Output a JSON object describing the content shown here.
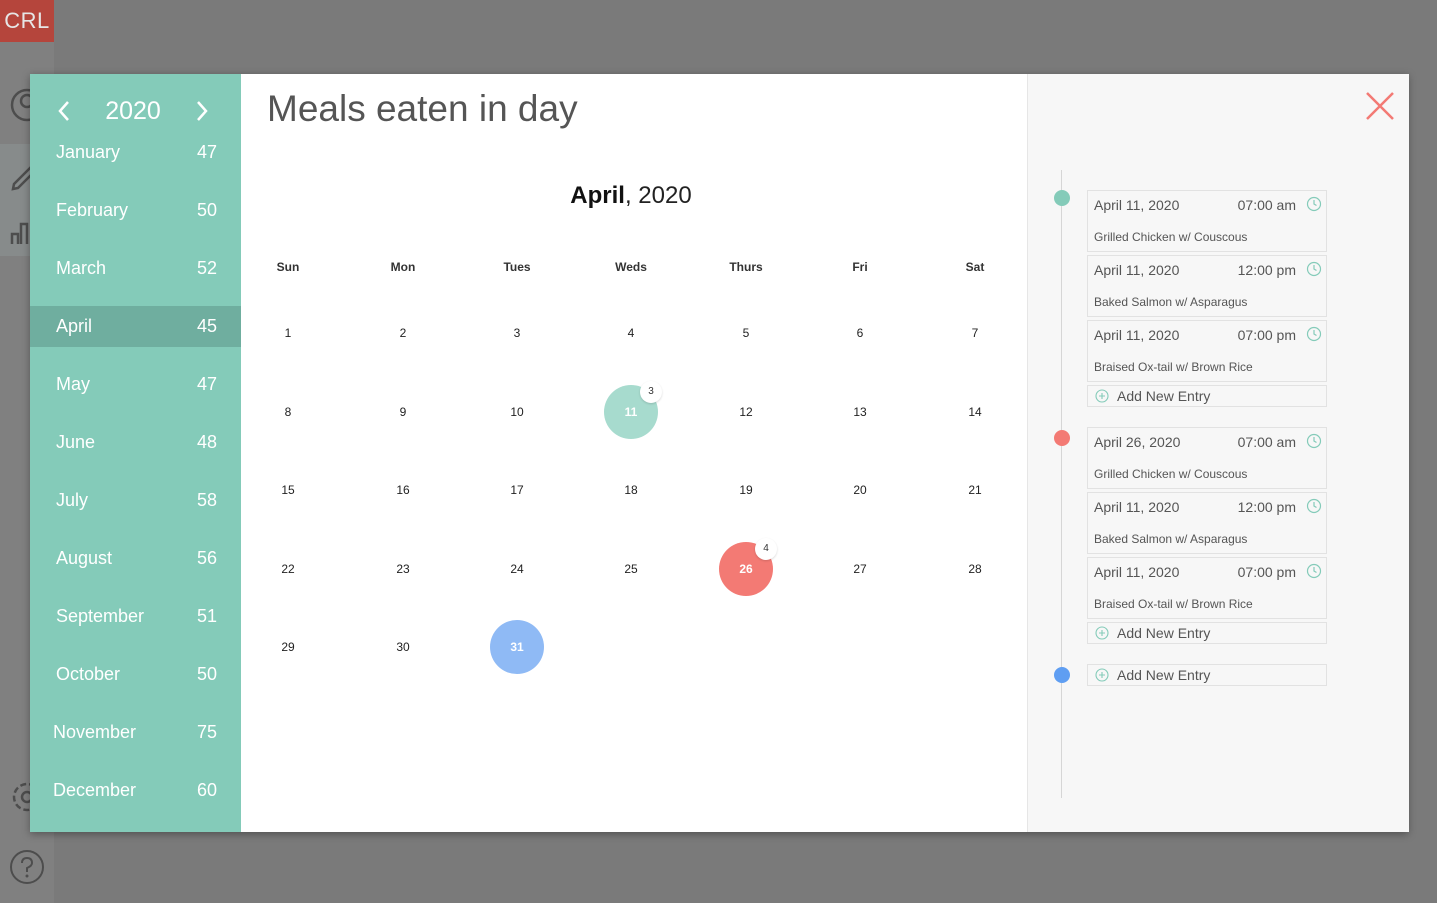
{
  "app": {
    "logo": "CRL"
  },
  "modal": {
    "title": "Meals eaten in day",
    "year": "2020",
    "months": [
      {
        "name": "January",
        "count": "47"
      },
      {
        "name": "February",
        "count": "50"
      },
      {
        "name": "March",
        "count": "52"
      },
      {
        "name": "April",
        "count": "45"
      },
      {
        "name": "May",
        "count": "47"
      },
      {
        "name": "June",
        "count": "48"
      },
      {
        "name": "July",
        "count": "58"
      },
      {
        "name": "August",
        "count": "56"
      },
      {
        "name": "September",
        "count": "51"
      },
      {
        "name": "October",
        "count": "50"
      },
      {
        "name": "November",
        "count": "75"
      },
      {
        "name": "December",
        "count": "60"
      }
    ],
    "selected_month": "April",
    "calendar": {
      "month": "April",
      "year_suffix": ", 2020",
      "weekdays": [
        "Sun",
        "Mon",
        "Tues",
        "Weds",
        "Thurs",
        "Fri",
        "Sat"
      ],
      "weeks": [
        [
          "1",
          "2",
          "3",
          "4",
          "5",
          "6",
          "7"
        ],
        [
          "8",
          "9",
          "10",
          "11",
          "12",
          "13",
          "14"
        ],
        [
          "15",
          "16",
          "17",
          "18",
          "19",
          "20",
          "21"
        ],
        [
          "22",
          "23",
          "24",
          "25",
          "26",
          "27",
          "28"
        ],
        [
          "29",
          "30",
          "31"
        ]
      ],
      "highlights": {
        "11": {
          "color": "#a7dbce",
          "badge": "3"
        },
        "26": {
          "color": "#f37a74",
          "badge": "4"
        },
        "31": {
          "color": "#8fbaf5"
        }
      }
    },
    "timeline": {
      "groups": [
        {
          "dot_color": "#84cbb9",
          "entries": [
            {
              "date": "April 11, 2020",
              "time": "07:00 am",
              "meal": "Grilled Chicken w/ Couscous"
            },
            {
              "date": "April 11, 2020",
              "time": "12:00 pm",
              "meal": "Baked Salmon w/ Asparagus"
            },
            {
              "date": "April 11, 2020",
              "time": "07:00 pm",
              "meal": "Braised Ox-tail w/ Brown Rice"
            }
          ],
          "add_label": "Add New Entry"
        },
        {
          "dot_color": "#f37a74",
          "entries": [
            {
              "date": "April 26, 2020",
              "time": "07:00 am",
              "meal": "Grilled Chicken w/ Couscous"
            },
            {
              "date": "April 11, 2020",
              "time": "12:00 pm",
              "meal": "Baked Salmon w/ Asparagus"
            },
            {
              "date": "April 11, 2020",
              "time": "07:00 pm",
              "meal": "Braised Ox-tail w/ Brown Rice"
            }
          ],
          "add_label": "Add New Entry"
        },
        {
          "dot_color": "#5f9ef2",
          "entries": [],
          "add_label": "Add New Entry"
        }
      ]
    },
    "colors": {
      "accent": "#84cbb9",
      "accent_dark": "#6fae9f",
      "close": "#f37a74",
      "clock": "#84cbb9"
    },
    "icons": [
      "chevron-left-icon",
      "chevron-right-icon",
      "close-icon",
      "clock-icon",
      "plus-circle-icon"
    ]
  }
}
